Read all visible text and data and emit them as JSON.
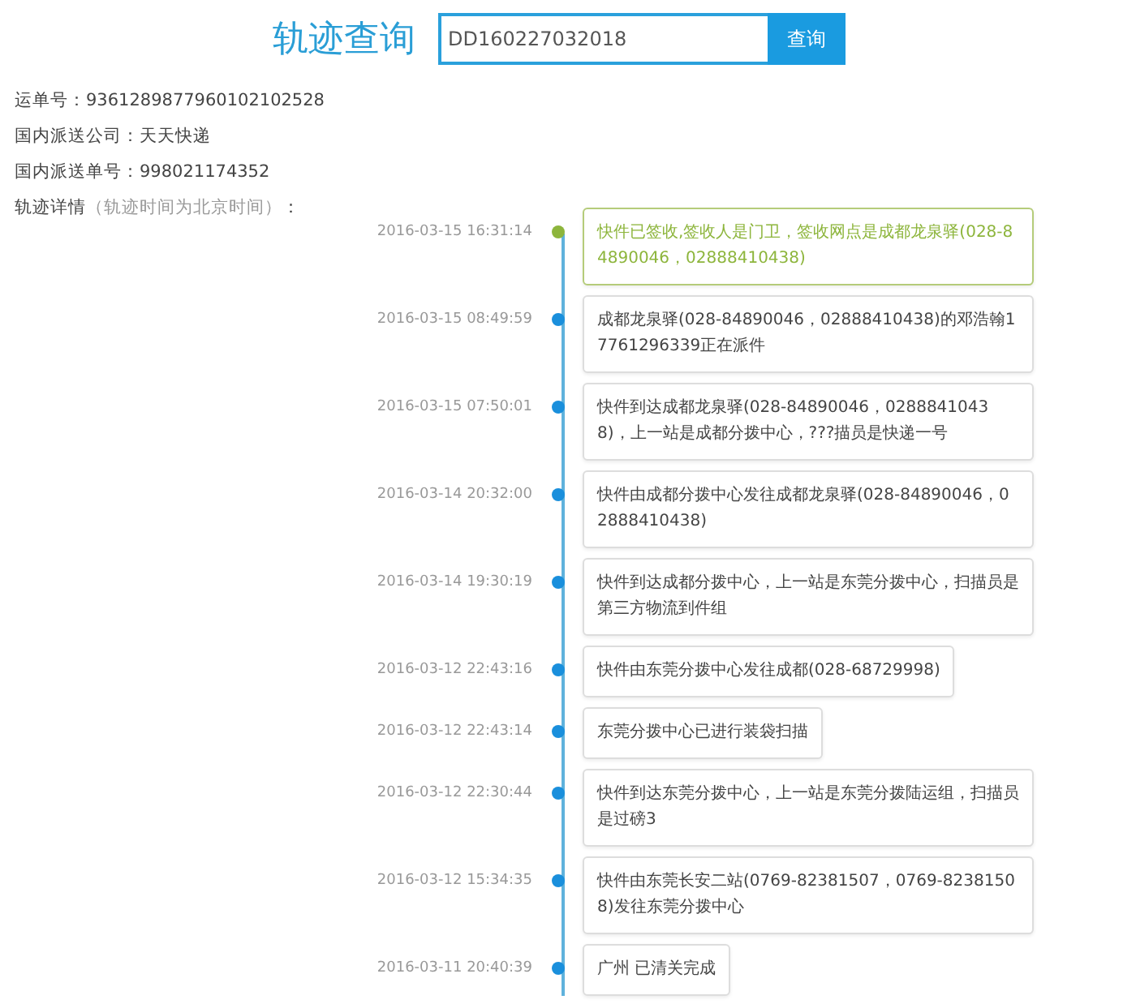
{
  "header": {
    "title": "轨迹查询",
    "search": {
      "value": "DD160227032018"
    },
    "button": "查询"
  },
  "info": [
    {
      "label": "运单号：",
      "value": "9361289877960102102528"
    },
    {
      "label": "国内派送公司：",
      "value": "天天快递"
    },
    {
      "label": "国内派送单号：",
      "value": "998021174352"
    }
  ],
  "details": {
    "label": "轨迹详情",
    "note": "（轨迹时间为北京时间）",
    "suffix": "："
  },
  "events": [
    {
      "time": "2016-03-15 16:31:14",
      "text": "快件已签收,签收人是门卫，签收网点是成都龙泉驿(028-84890046，02888410438)",
      "latest": true
    },
    {
      "time": "2016-03-15 08:49:59",
      "text": "成都龙泉驿(028-84890046，02888410438)的邓浩翰17761296339正在派件",
      "latest": false
    },
    {
      "time": "2016-03-15 07:50:01",
      "text": "快件到达成都龙泉驿(028-84890046，02888410438)，上一站是成都分拨中心，???描员是快递一号",
      "latest": false
    },
    {
      "time": "2016-03-14 20:32:00",
      "text": "快件由成都分拨中心发往成都龙泉驿(028-84890046，02888410438)",
      "latest": false
    },
    {
      "time": "2016-03-14 19:30:19",
      "text": "快件到达成都分拨中心，上一站是东莞分拨中心，扫描员是第三方物流到件组",
      "latest": false
    },
    {
      "time": "2016-03-12 22:43:16",
      "text": "快件由东莞分拨中心发往成都(028-68729998)",
      "latest": false
    },
    {
      "time": "2016-03-12 22:43:14",
      "text": "东莞分拨中心已进行装袋扫描",
      "latest": false
    },
    {
      "time": "2016-03-12 22:30:44",
      "text": "快件到达东莞分拨中心，上一站是东莞分拨陆运组，扫描员是过磅3",
      "latest": false
    },
    {
      "time": "2016-03-12 15:34:35",
      "text": "快件由东莞长安二站(0769-82381507，0769-82381508)发往东莞分拨中心",
      "latest": false
    },
    {
      "time": "2016-03-11 20:40:39",
      "text": "广州 已清关完成",
      "latest": false
    }
  ]
}
